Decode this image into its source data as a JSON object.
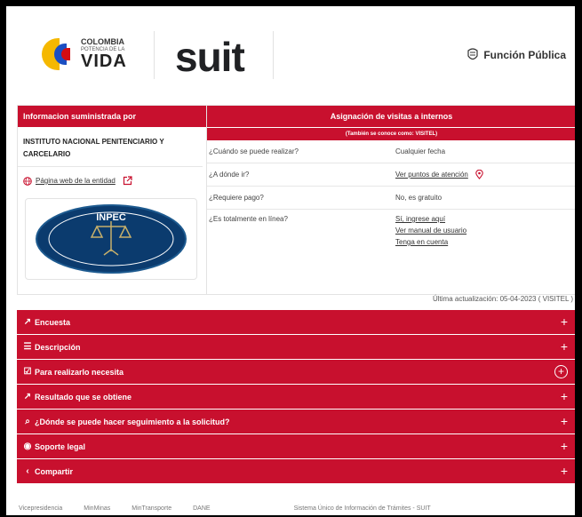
{
  "header": {
    "colombia_line1": "COLOMBIA",
    "colombia_line2": "POTENCIA DE LA",
    "colombia_line3": "VIDA",
    "suit_logo": "suit",
    "funcion_publica": "Función Pública"
  },
  "left_panel": {
    "title": "Informacion suministrada por",
    "institution": "INSTITUTO NACIONAL PENITENCIARIO Y CARCELARIO",
    "website_link": "Página web de la entidad",
    "logo_text": "INPEC"
  },
  "right_panel": {
    "title": "Asignación de visitas a internos",
    "subtitle": "(También se conoce como: VISITEL)",
    "rows": [
      {
        "label": "¿Cuándo se puede realizar?",
        "value": "Cualquier fecha"
      },
      {
        "label": "¿A dónde ir?",
        "value": "Ver puntos de atención"
      },
      {
        "label": "¿Requiere pago?",
        "value": "No, es gratuito"
      },
      {
        "label": "¿Es totalmente en línea?",
        "values": [
          "Sí, ingrese aquí",
          "Ver manual de usuario",
          "Tenga en cuenta"
        ]
      }
    ]
  },
  "last_update": "Última actualización: 05-04-2023 ( VISITEL )",
  "accordion": [
    {
      "label": "Encuesta",
      "icon": "external-link-icon"
    },
    {
      "label": "Descripción",
      "icon": "document-icon"
    },
    {
      "label": "Para realizarlo necesita",
      "icon": "checklist-icon"
    },
    {
      "label": "Resultado que se obtiene",
      "icon": "chart-icon"
    },
    {
      "label": "¿Dónde se puede hacer seguimiento a la solicitud?",
      "icon": "search-icon"
    },
    {
      "label": "Soporte legal",
      "icon": "legal-icon"
    },
    {
      "label": "Compartir",
      "icon": "share-icon"
    }
  ],
  "footer": [
    "Vicepresidencia",
    "MinMinas",
    "MinTransporte",
    "DANE",
    "Sistema Único de Información de Trámites - SUIT"
  ],
  "colors": {
    "brand_red": "#c8102e"
  }
}
